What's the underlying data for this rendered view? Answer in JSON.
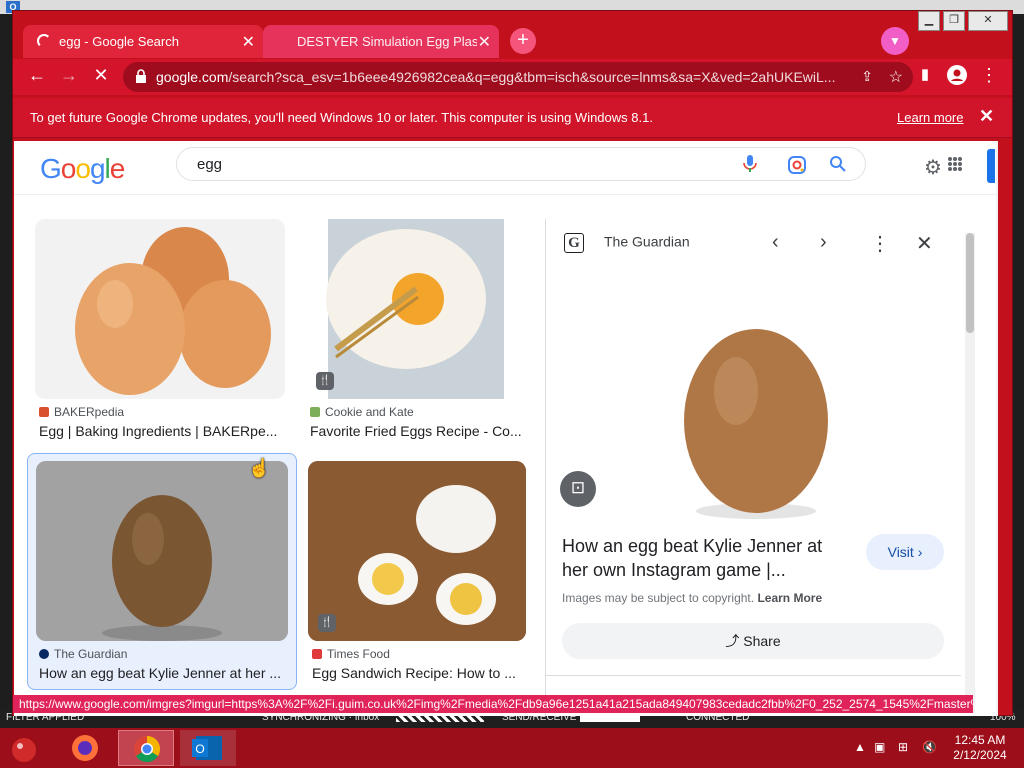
{
  "background_app": {
    "status_filter": "FILTER APPLIED",
    "status_sync": "SYNCHRONIZING · Inbox",
    "status_send": "SEND/RECEIVE",
    "status_connected": "CONNECTED",
    "status_zoom": "100%"
  },
  "browser": {
    "tabs": [
      {
        "title": "egg - Google Search",
        "active": true
      },
      {
        "title": "DESTYER Simulation Egg Plastic",
        "active": false
      }
    ],
    "url_host": "google.com",
    "url_rest": "/search?sca_esv=1b6eee4926982cea&q=egg&tbm=isch&source=lnms&sa=X&ved=2ahUKEwiL...",
    "infobar_message": "To get future Google Chrome updates, you'll need Windows 10 or later. This computer is using Windows 8.1.",
    "infobar_link": "Learn more",
    "status_url": "https://www.google.com/imgres?imgurl=https%3A%2F%2Fi.guim.co.uk%2Fimg%2Fmedia%2Fdb9a96e1251a41a215ada849407983cedadc2fbb%2F0_252_2574_1545%2Fmaster%2..."
  },
  "google": {
    "logo": "Google",
    "query": "egg"
  },
  "results": [
    {
      "source": "BAKERpedia",
      "title": "Egg | Baking Ingredients | BAKERpe..."
    },
    {
      "source": "Cookie and Kate",
      "title": "Favorite Fried Eggs Recipe - Co..."
    },
    {
      "source": "The Guardian",
      "title": "How an egg beat Kylie Jenner at her ..."
    },
    {
      "source": "Times Food",
      "title": "Egg Sandwich Recipe: How to ..."
    }
  ],
  "panel": {
    "source": "The Guardian",
    "title": "How an egg beat Kylie Jenner at her own Instagram game |...",
    "visit": "Visit",
    "copyright": "Images may be subject to copyright.",
    "copyright_link": "Learn More",
    "share": "Share"
  },
  "taskbar": {
    "time": "12:45 AM",
    "date": "2/12/2024"
  },
  "colors": {
    "chrome_frame": "#c3101d",
    "google_blue": "#4285f4",
    "google_red": "#ea4335",
    "google_yellow": "#fbbc05",
    "google_green": "#34a853"
  }
}
